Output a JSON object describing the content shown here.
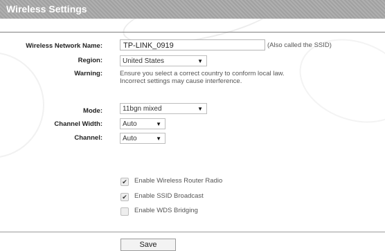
{
  "header": {
    "title": "Wireless Settings"
  },
  "form": {
    "network_name": {
      "label": "Wireless Network Name:",
      "value": "TP-LINK_0919",
      "hint": "(Also called the SSID)"
    },
    "region": {
      "label": "Region:",
      "value": "United States"
    },
    "warning": {
      "label": "Warning:",
      "line1": "Ensure you select a correct country to conform local law.",
      "line2": "Incorrect settings may cause interference."
    },
    "mode": {
      "label": "Mode:",
      "value": "11bgn mixed"
    },
    "channel_width": {
      "label": "Channel Width:",
      "value": "Auto"
    },
    "channel": {
      "label": "Channel:",
      "value": "Auto"
    }
  },
  "options": [
    {
      "label": "Enable Wireless Router Radio",
      "checked": true
    },
    {
      "label": "Enable SSID Broadcast",
      "checked": true
    },
    {
      "label": "Enable WDS Bridging",
      "checked": false
    }
  ],
  "buttons": {
    "save": "Save"
  },
  "icons": {
    "dropdown": "dropdown-arrow-icon",
    "check": "check-icon"
  }
}
